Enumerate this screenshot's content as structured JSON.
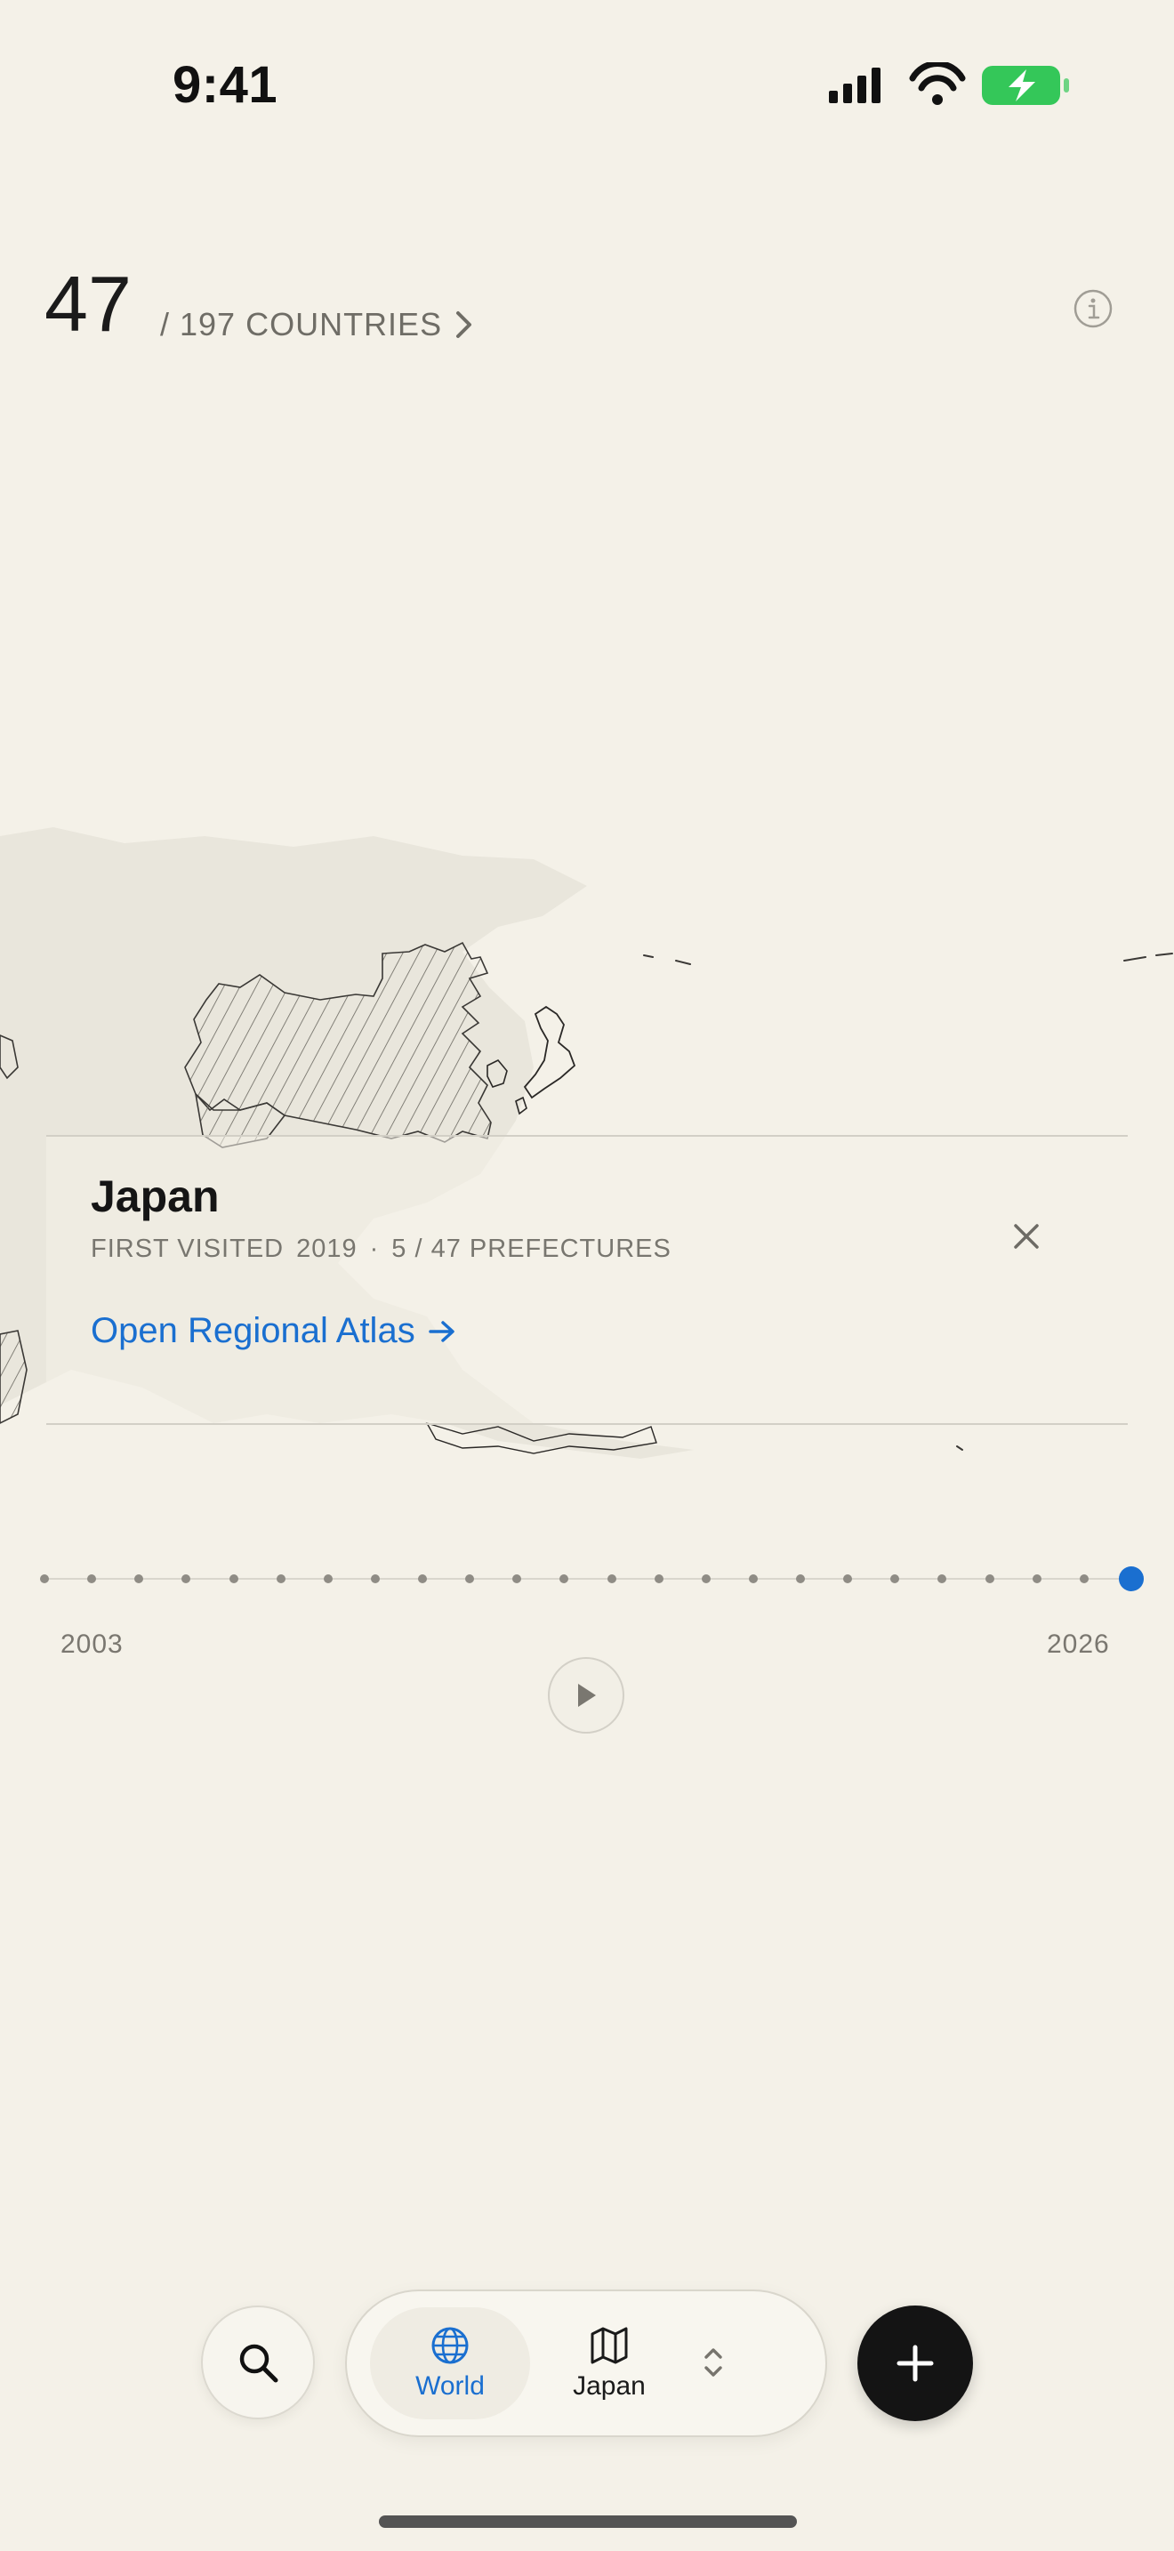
{
  "status_bar": {
    "time": "9:41"
  },
  "header": {
    "visited_count": "47",
    "total_label": "/ 197 COUNTRIES"
  },
  "card": {
    "title": "Japan",
    "first_visited_label": "FIRST VISITED",
    "first_visited_year": "2019",
    "separator": "·",
    "prefectures": "5 / 47 PREFECTURES",
    "link_label": "Open Regional Atlas"
  },
  "timeline": {
    "start_year": "2003",
    "end_year": "2026",
    "steps": 24,
    "active_index": 23
  },
  "bottom_bar": {
    "tabs": [
      {
        "label": "World",
        "icon": "globe-icon",
        "selected": true
      },
      {
        "label": "Japan",
        "icon": "map-icon",
        "selected": false
      }
    ]
  },
  "colors": {
    "background": "#f4f1e8",
    "accent": "#1a6fd0",
    "battery": "#34c759"
  }
}
